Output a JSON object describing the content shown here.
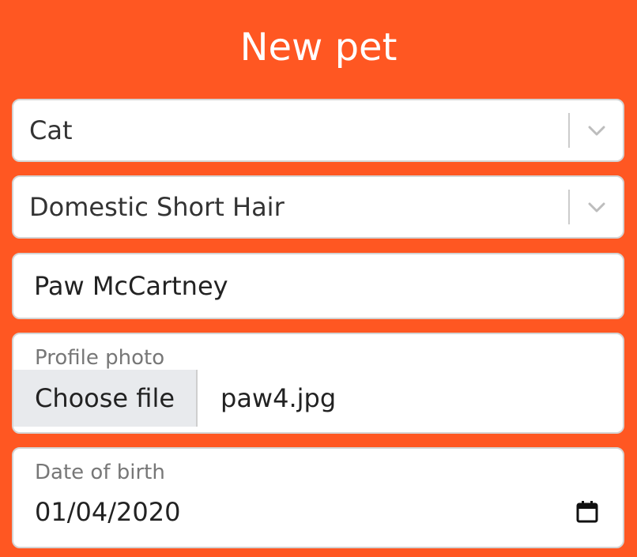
{
  "page": {
    "title": "New pet",
    "accent_color": "#FF5722"
  },
  "form": {
    "species_select": {
      "selected": "Cat",
      "icon": "chevron-down-icon"
    },
    "breed_select": {
      "selected": "Domestic Short Hair",
      "icon": "chevron-down-icon"
    },
    "name_input": {
      "value": "Paw McCartney"
    },
    "profile_photo": {
      "label": "Profile photo",
      "button_label": "Choose file",
      "file_name": "paw4.jpg"
    },
    "date_of_birth": {
      "label": "Date of birth",
      "value": "01/04/2020",
      "icon": "calendar-icon"
    }
  }
}
